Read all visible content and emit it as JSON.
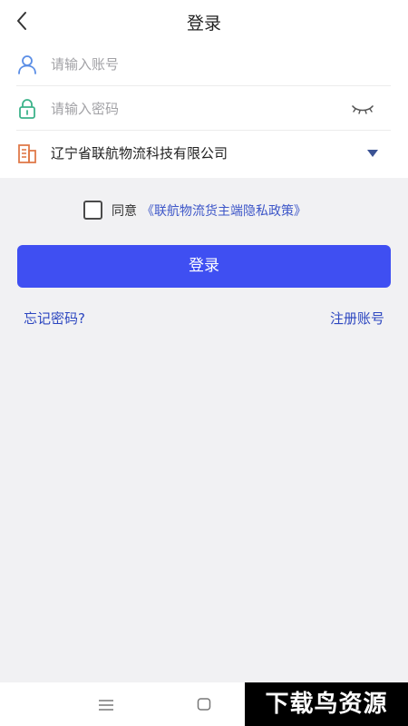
{
  "header": {
    "title": "登录",
    "back_icon": "chevron-left-icon"
  },
  "form": {
    "account": {
      "placeholder": "请输入账号",
      "value": "",
      "icon": "user-icon",
      "icon_color": "#5b8ee6"
    },
    "password": {
      "placeholder": "请输入密码",
      "value": "",
      "icon": "lock-icon",
      "icon_color": "#3db38a",
      "toggle_icon": "eye-closed-icon"
    },
    "company": {
      "value": "辽宁省联航物流科技有限公司",
      "icon": "building-icon",
      "icon_color": "#e07a4a",
      "dropdown_icon": "caret-down-icon"
    }
  },
  "agreement": {
    "prefix": "同意",
    "policy_link": "《联航物流货主端隐私政策》",
    "checked": false
  },
  "actions": {
    "login_label": "登录",
    "forgot_label": "忘记密码?",
    "register_label": "注册账号"
  },
  "colors": {
    "primary": "#3f4ff2",
    "link": "#2d47c0",
    "background": "#f1f1f3"
  },
  "watermark": {
    "text": "下载鸟资源"
  },
  "navbar": {
    "menu_icon": "menu-icon",
    "home_icon": "home-square-icon"
  }
}
